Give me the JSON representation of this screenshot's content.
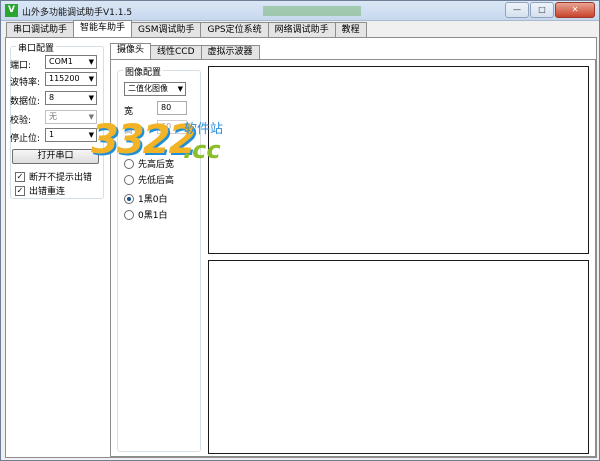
{
  "window": {
    "title": "山外多功能调试助手V1.1.5",
    "icon_letter": "V",
    "minimize": "—",
    "maximize": "□",
    "close": "✕"
  },
  "tabs": [
    "串口调试助手",
    "智能车助手",
    "GSM调试助手",
    "GPS定位系统",
    "网络调试助手",
    "教程"
  ],
  "serial": {
    "group_title": "串口配置",
    "port_label": "端口:",
    "port_value": "COM1",
    "baud_label": "波特率:",
    "baud_value": "115200",
    "databits_label": "数据位:",
    "databits_value": "8",
    "parity_label": "校验:",
    "parity_value": "无",
    "stopbits_label": "停止位:",
    "stopbits_value": "1",
    "open_button": "打开串口",
    "no_prompt_label": "断开不提示出错",
    "no_prompt_checked": "✓",
    "reconnect_label": "出错重连",
    "reconnect_checked": "✓"
  },
  "subtabs": [
    "摄像头",
    "线性CCD",
    "虚拟示波器"
  ],
  "camera": {
    "group_title": "图像配置",
    "image_type": "二值化图像",
    "width_label": "宽",
    "width_value": "80",
    "height_label": "高",
    "height_value": "60",
    "order_high_first": "先高后宽",
    "order_low_first": "先低后高",
    "color_1black": "1黑0白",
    "color_0black": "0黑1白"
  },
  "watermark": {
    "number": "3322",
    "suffix": ".cc",
    "site": "软件站"
  },
  "colors": {
    "title_bar": "#c7d8ee",
    "close_button": "#c9432b",
    "app_icon": "#2aa532"
  }
}
